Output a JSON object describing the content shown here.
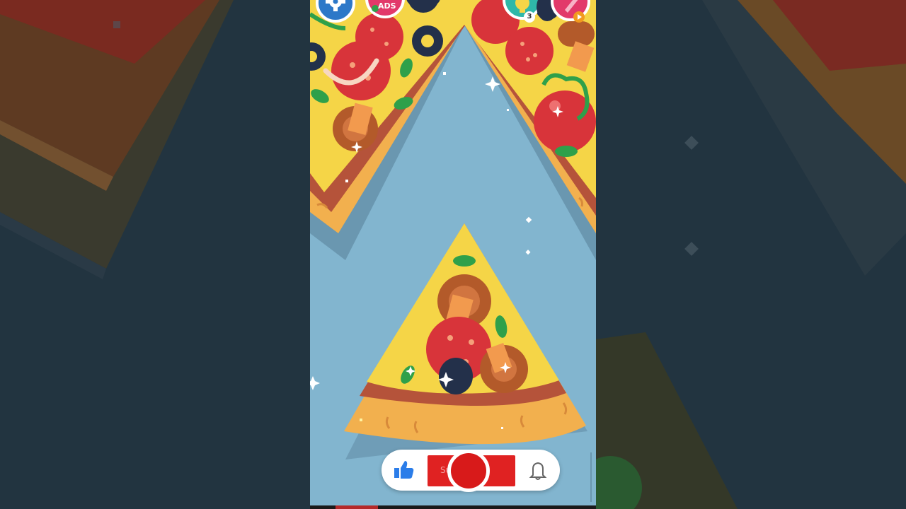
{
  "hud": {
    "no_ads_label": "ADS",
    "hint_count": "3"
  },
  "subscribe": {
    "button_label": "Subscribe"
  },
  "colors": {
    "background_sky": "#82b5cf",
    "side_dark": "#1e2e38",
    "cheese": "#f5d547",
    "crust": "#f2b04e",
    "sauce_band": "#b5533a",
    "pepperoni": "#d8343a",
    "mushroom": "#b35a2a",
    "olive": "#23304a",
    "leaf": "#2fa04a",
    "subscribe_red": "#e02222",
    "like_blue": "#2b7de9"
  },
  "icons": {
    "settings": "gear-icon",
    "no_ads": "no-ads-icon",
    "hint": "lightbulb-icon",
    "shop": "brush-icon",
    "like": "thumbs-up-icon",
    "bell": "bell-icon"
  }
}
